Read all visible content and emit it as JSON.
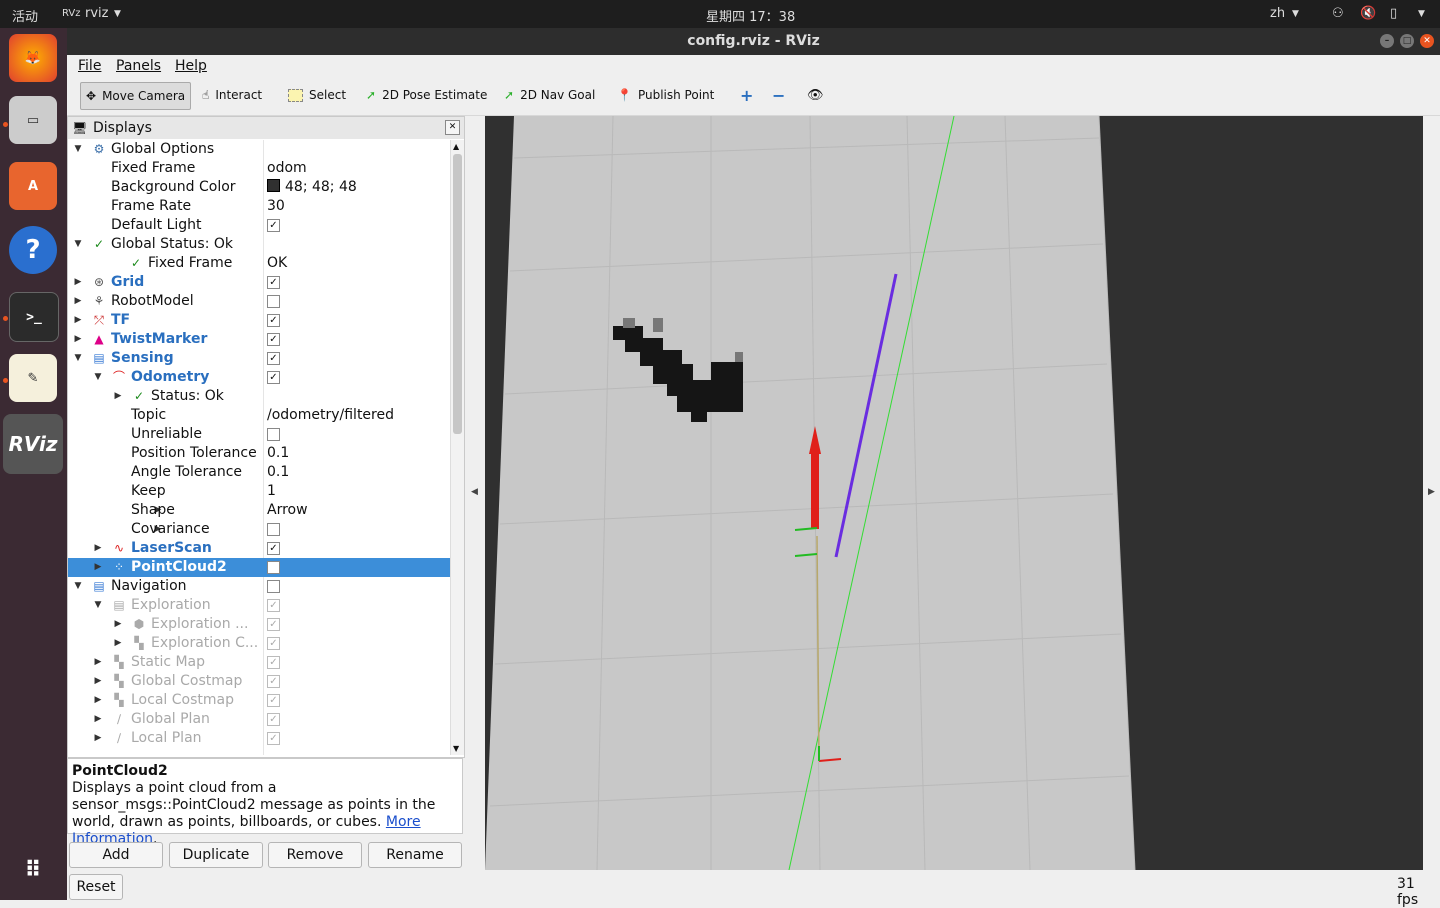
{
  "topbar": {
    "activities": "活动",
    "app_name": "rviz",
    "clock": "星期四 17：38",
    "lang": "zh"
  },
  "window": {
    "title": "config.rviz - RViz"
  },
  "menu": {
    "file": "File",
    "panels": "Panels",
    "help": "Help"
  },
  "toolbar": {
    "move_camera": "Move Camera",
    "interact": "Interact",
    "select": "Select",
    "pose_estimate": "2D Pose Estimate",
    "nav_goal": "2D Nav Goal",
    "publish_point": "Publish Point"
  },
  "displays": {
    "title": "Displays",
    "rows": [
      {
        "label": "Global Options",
        "value": ""
      },
      {
        "label": "Fixed Frame",
        "value": "odom"
      },
      {
        "label": "Background Color",
        "value": "48; 48; 48"
      },
      {
        "label": "Frame Rate",
        "value": "30"
      },
      {
        "label": "Default Light",
        "value": ""
      },
      {
        "label": "Global Status: Ok",
        "value": ""
      },
      {
        "label": "Fixed Frame",
        "value": "OK"
      },
      {
        "label": "Grid",
        "value": ""
      },
      {
        "label": "RobotModel",
        "value": ""
      },
      {
        "label": "TF",
        "value": ""
      },
      {
        "label": "TwistMarker",
        "value": ""
      },
      {
        "label": "Sensing",
        "value": ""
      },
      {
        "label": "Odometry",
        "value": ""
      },
      {
        "label": "Status: Ok",
        "value": ""
      },
      {
        "label": "Topic",
        "value": "/odometry/filtered"
      },
      {
        "label": "Unreliable",
        "value": ""
      },
      {
        "label": "Position Tolerance",
        "value": "0.1"
      },
      {
        "label": "Angle Tolerance",
        "value": "0.1"
      },
      {
        "label": "Keep",
        "value": "1"
      },
      {
        "label": "Shape",
        "value": "Arrow"
      },
      {
        "label": "Covariance",
        "value": ""
      },
      {
        "label": "LaserScan",
        "value": ""
      },
      {
        "label": "PointCloud2",
        "value": ""
      },
      {
        "label": "Navigation",
        "value": ""
      },
      {
        "label": "Exploration",
        "value": ""
      },
      {
        "label": "Exploration ...",
        "value": ""
      },
      {
        "label": "Exploration C...",
        "value": ""
      },
      {
        "label": "Static Map",
        "value": ""
      },
      {
        "label": "Global Costmap",
        "value": ""
      },
      {
        "label": "Local Costmap",
        "value": ""
      },
      {
        "label": "Global Plan",
        "value": ""
      },
      {
        "label": "Local Plan",
        "value": ""
      }
    ]
  },
  "description": {
    "title": "PointCloud2",
    "text": "Displays a point cloud from a sensor_msgs::PointCloud2 message as points in the world, drawn as points, billboards, or cubes.",
    "link": "More Information",
    "after_link": "."
  },
  "buttons": {
    "add": "Add",
    "duplicate": "Duplicate",
    "remove": "Remove",
    "rename": "Rename",
    "reset": "Reset"
  },
  "status": {
    "fps": "31 fps"
  },
  "colors": {
    "selection": "#3c8ed9",
    "background": "#303030",
    "map_free": "#c8c8c8",
    "odometry_arrow": "#e0201a",
    "path": "#6a2de0"
  }
}
